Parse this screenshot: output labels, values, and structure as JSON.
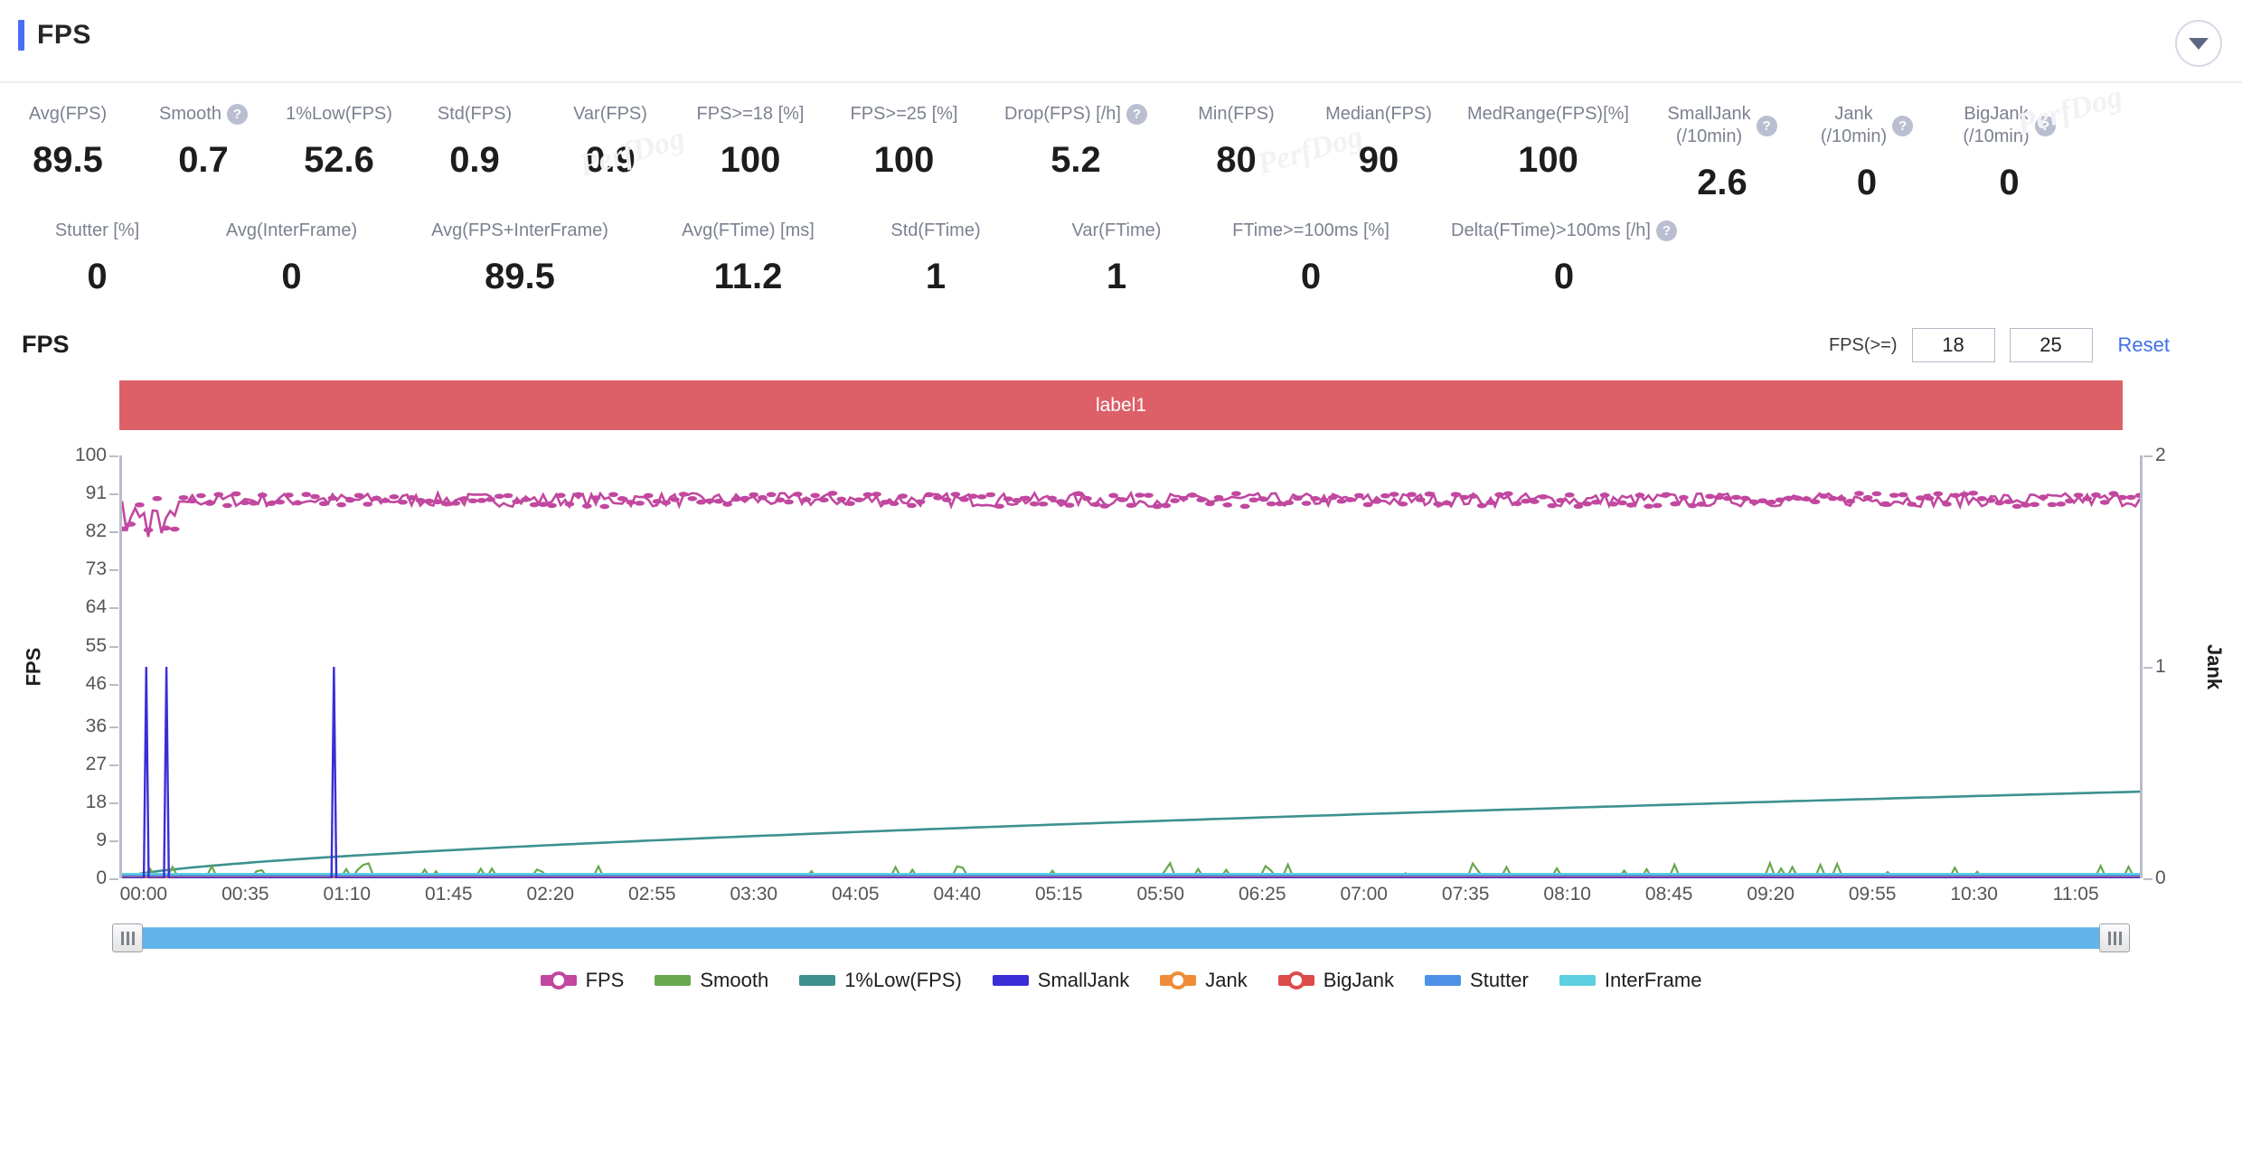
{
  "header": {
    "title": "FPS",
    "accent_color": "#4b6ef5",
    "collapse_icon": "chevron-down-icon"
  },
  "watermark": "PerfDog",
  "metrics": {
    "row1": [
      {
        "label": "Avg(FPS)",
        "value": "89.5",
        "help": false
      },
      {
        "label": "Smooth",
        "value": "0.7",
        "help": true
      },
      {
        "label": "1%Low(FPS)",
        "value": "52.6",
        "help": false
      },
      {
        "label": "Std(FPS)",
        "value": "0.9",
        "help": false
      },
      {
        "label": "Var(FPS)",
        "value": "0.9",
        "help": false
      },
      {
        "label": "FPS>=18 [%]",
        "value": "100",
        "help": false
      },
      {
        "label": "FPS>=25 [%]",
        "value": "100",
        "help": false
      },
      {
        "label": "Drop(FPS) [/h]",
        "value": "5.2",
        "help": true
      },
      {
        "label": "Min(FPS)",
        "value": "80",
        "help": false
      },
      {
        "label": "Median(FPS)",
        "value": "90",
        "help": false
      },
      {
        "label": "MedRange(FPS)[%]",
        "value": "100",
        "help": false
      },
      {
        "label": "SmallJank\n(/10min)",
        "value": "2.6",
        "help": true
      },
      {
        "label": "Jank\n(/10min)",
        "value": "0",
        "help": true
      },
      {
        "label": "BigJank\n(/10min)",
        "value": "0",
        "help": true
      }
    ],
    "row2": [
      {
        "label": "Stutter [%]",
        "value": "0",
        "help": false
      },
      {
        "label": "Avg(InterFrame)",
        "value": "0",
        "help": false
      },
      {
        "label": "Avg(FPS+InterFrame)",
        "value": "89.5",
        "help": false
      },
      {
        "label": "Avg(FTime) [ms]",
        "value": "11.2",
        "help": false
      },
      {
        "label": "Std(FTime)",
        "value": "1",
        "help": false
      },
      {
        "label": "Var(FTime)",
        "value": "1",
        "help": false
      },
      {
        "label": "FTime>=100ms [%]",
        "value": "0",
        "help": false
      },
      {
        "label": "Delta(FTime)>100ms [/h]",
        "value": "0",
        "help": true
      }
    ]
  },
  "chart_section": {
    "title": "FPS",
    "controls": {
      "label": "FPS(>=)",
      "threshold_low": "18",
      "threshold_high": "25",
      "reset_label": "Reset"
    },
    "label_bar": {
      "text": "label1",
      "color": "#dd6068"
    }
  },
  "chart_data": {
    "type": "line",
    "title": "FPS",
    "xlabel": "",
    "ylabel": "FPS",
    "y2label": "Jank",
    "ylim": [
      0,
      100
    ],
    "y2lim": [
      0,
      2
    ],
    "grid": false,
    "legend_position": "bottom",
    "yticks": [
      100,
      91,
      82,
      73,
      64,
      55,
      46,
      36,
      27,
      18,
      9,
      0
    ],
    "y2ticks": [
      2,
      1,
      0
    ],
    "xticks": [
      "00:00",
      "00:35",
      "01:10",
      "01:45",
      "02:20",
      "02:55",
      "03:30",
      "04:05",
      "04:40",
      "05:15",
      "05:50",
      "06:25",
      "07:00",
      "07:35",
      "08:10",
      "08:45",
      "09:20",
      "09:55",
      "10:30",
      "11:05"
    ],
    "series": [
      {
        "name": "FPS",
        "color": "#c1479f",
        "axis": "left",
        "mean": 89.5,
        "min": 80,
        "note": "dense noisy band near 89-91 with dips to ~80 early"
      },
      {
        "name": "Smooth",
        "color": "#6aa84f",
        "axis": "left",
        "mean": 0.7,
        "note": "near-zero jagged line along baseline"
      },
      {
        "name": "1%Low(FPS)",
        "color": "#3d9190",
        "axis": "left",
        "mean": 52.6,
        "note": "smooth rising curve from 0 to ~20"
      },
      {
        "name": "SmallJank",
        "color": "#3b2ed6",
        "axis": "right",
        "note": "three tall spikes near 00:05, 00:20 and 01:12"
      },
      {
        "name": "Jank",
        "color": "#f08b38",
        "axis": "right",
        "note": "flat at 0"
      },
      {
        "name": "BigJank",
        "color": "#dd4b4b",
        "axis": "right",
        "note": "flat at 0"
      },
      {
        "name": "Stutter",
        "color": "#4d92e8",
        "axis": "left",
        "note": "flat at 0"
      },
      {
        "name": "InterFrame",
        "color": "#5ecfe0",
        "axis": "left",
        "note": "flat at 0"
      }
    ],
    "legend": [
      {
        "name": "FPS",
        "color": "#c1479f",
        "marker": "dot"
      },
      {
        "name": "Smooth",
        "color": "#6aa84f",
        "marker": "line"
      },
      {
        "name": "1%Low(FPS)",
        "color": "#3d9190",
        "marker": "line"
      },
      {
        "name": "SmallJank",
        "color": "#3b2ed6",
        "marker": "line"
      },
      {
        "name": "Jank",
        "color": "#f08b38",
        "marker": "dot"
      },
      {
        "name": "BigJank",
        "color": "#dd4b4b",
        "marker": "dot"
      },
      {
        "name": "Stutter",
        "color": "#4d92e8",
        "marker": "line"
      },
      {
        "name": "InterFrame",
        "color": "#5ecfe0",
        "marker": "line"
      }
    ]
  },
  "range_scrollbar": {
    "left_handle": "range-left-handle",
    "right_handle": "range-right-handle",
    "fill_color": "#62b4ea"
  }
}
